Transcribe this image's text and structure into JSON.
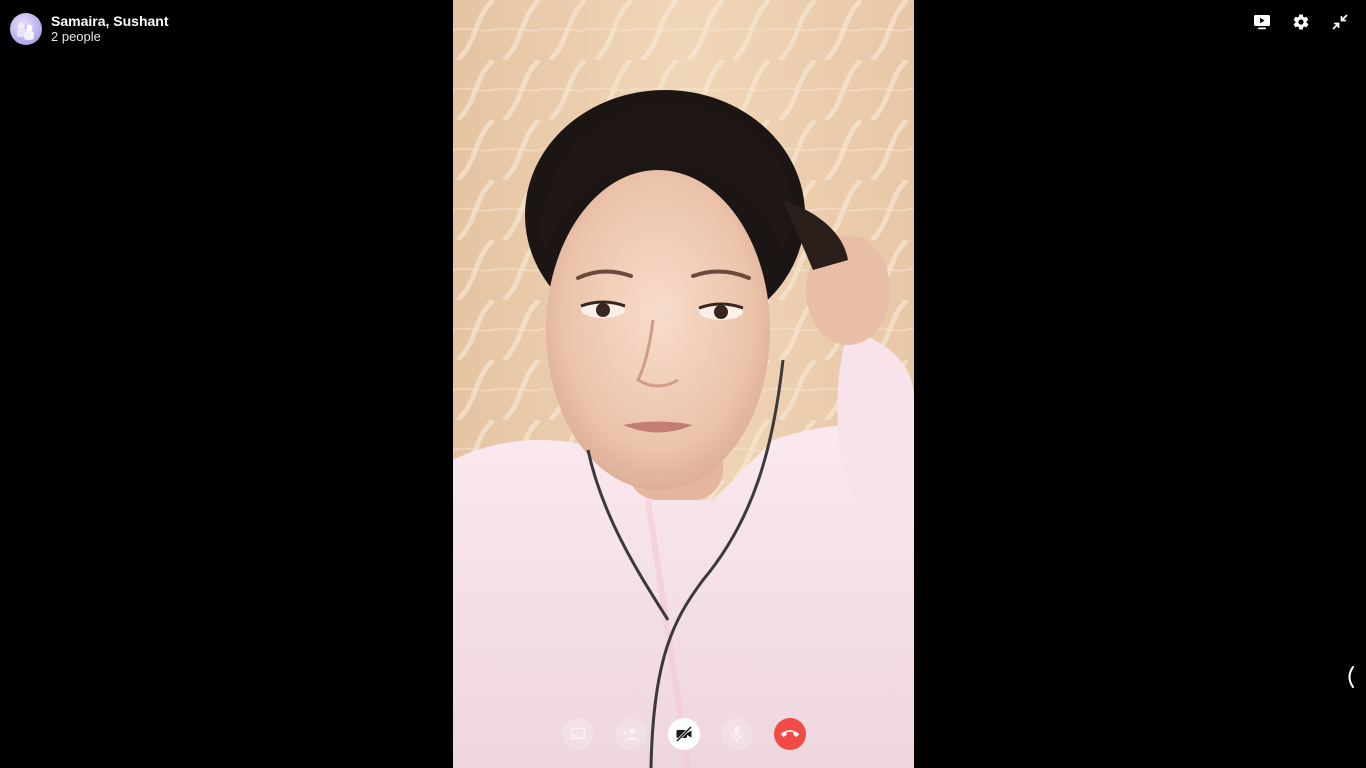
{
  "call": {
    "title": "Samaira, Sushant",
    "subtitle": "2 people"
  },
  "top_controls": [
    {
      "name": "share-screen-icon"
    },
    {
      "name": "settings-gear-icon"
    },
    {
      "name": "exit-fullscreen-icon"
    }
  ],
  "call_controls": [
    {
      "name": "share-screen-button",
      "state": "disabled"
    },
    {
      "name": "add-people-button",
      "state": "disabled"
    },
    {
      "name": "camera-off-button",
      "state": "active"
    },
    {
      "name": "microphone-button",
      "state": "disabled"
    },
    {
      "name": "end-call-button",
      "state": "active"
    }
  ],
  "colors": {
    "background": "#000000",
    "end_call": "#f04b45",
    "avatar": "#b5a6ea"
  }
}
